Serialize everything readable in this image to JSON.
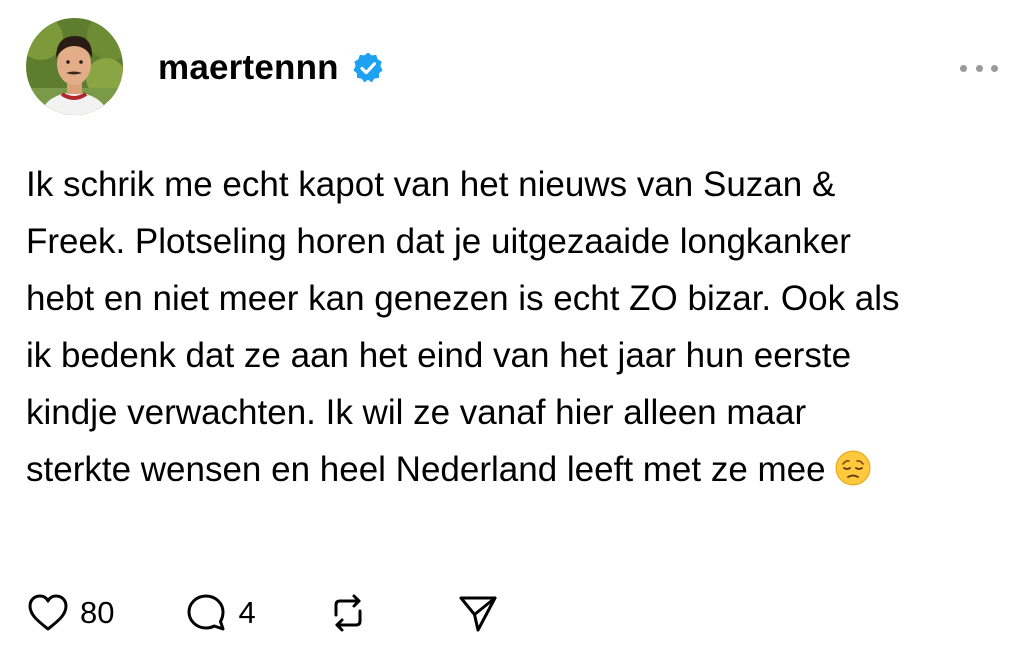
{
  "post": {
    "author": {
      "username": "maertennn",
      "verified": true,
      "avatar_icon": "profile-photo"
    },
    "text_lines": [
      "Ik schrik me echt kapot van het nieuws van Suzan &",
      "Freek. Plotseling horen dat je uitgezaaide longkanker",
      "hebt en niet meer kan genezen is echt ZO bizar. Ook als",
      "ik bedenk dat ze aan het eind van het jaar hun eerste",
      "kindje verwachten. Ik wil ze vanaf hier alleen maar",
      "sterkte wensen en heel Nederland leeft met ze mee"
    ],
    "trailing_emoji": "pensive-face-emoji",
    "actions": {
      "like": {
        "icon": "heart-icon",
        "count": "80"
      },
      "reply": {
        "icon": "comment-bubble-icon",
        "count": "4"
      },
      "repost": {
        "icon": "repost-icon"
      },
      "share": {
        "icon": "send-icon"
      }
    },
    "more_icon": "ellipsis-icon"
  },
  "colors": {
    "verified_badge": "#1DA1F2",
    "text": "#000000",
    "muted": "#9a9a9a",
    "background": "#ffffff"
  }
}
